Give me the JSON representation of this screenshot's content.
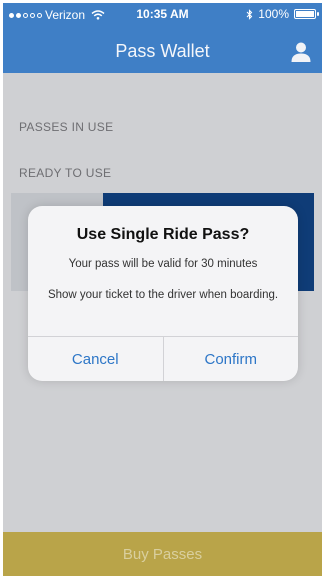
{
  "status_bar": {
    "carrier": "Verizon",
    "time": "10:35 AM",
    "battery": "100%",
    "battery_level": 1.0,
    "signal_bars_filled": 2,
    "signal_bars_total": 5
  },
  "nav": {
    "title": "Pass Wallet",
    "user_icon": "person-icon"
  },
  "sections": {
    "in_use": "PASSES IN USE",
    "ready": "READY TO USE"
  },
  "alert": {
    "title": "Use Single Ride Pass?",
    "message_1": "Your pass will be valid for 30 minutes",
    "message_2": "Show your ticket to the driver when boarding.",
    "cancel": "Cancel",
    "confirm": "Confirm"
  },
  "bottom": {
    "label": "Buy Passes"
  },
  "colors": {
    "header": "#3f7fc6",
    "accent_button": "#2d76c7",
    "bottom_bar": "#b9a449",
    "pass_card": "#0f3c77"
  }
}
